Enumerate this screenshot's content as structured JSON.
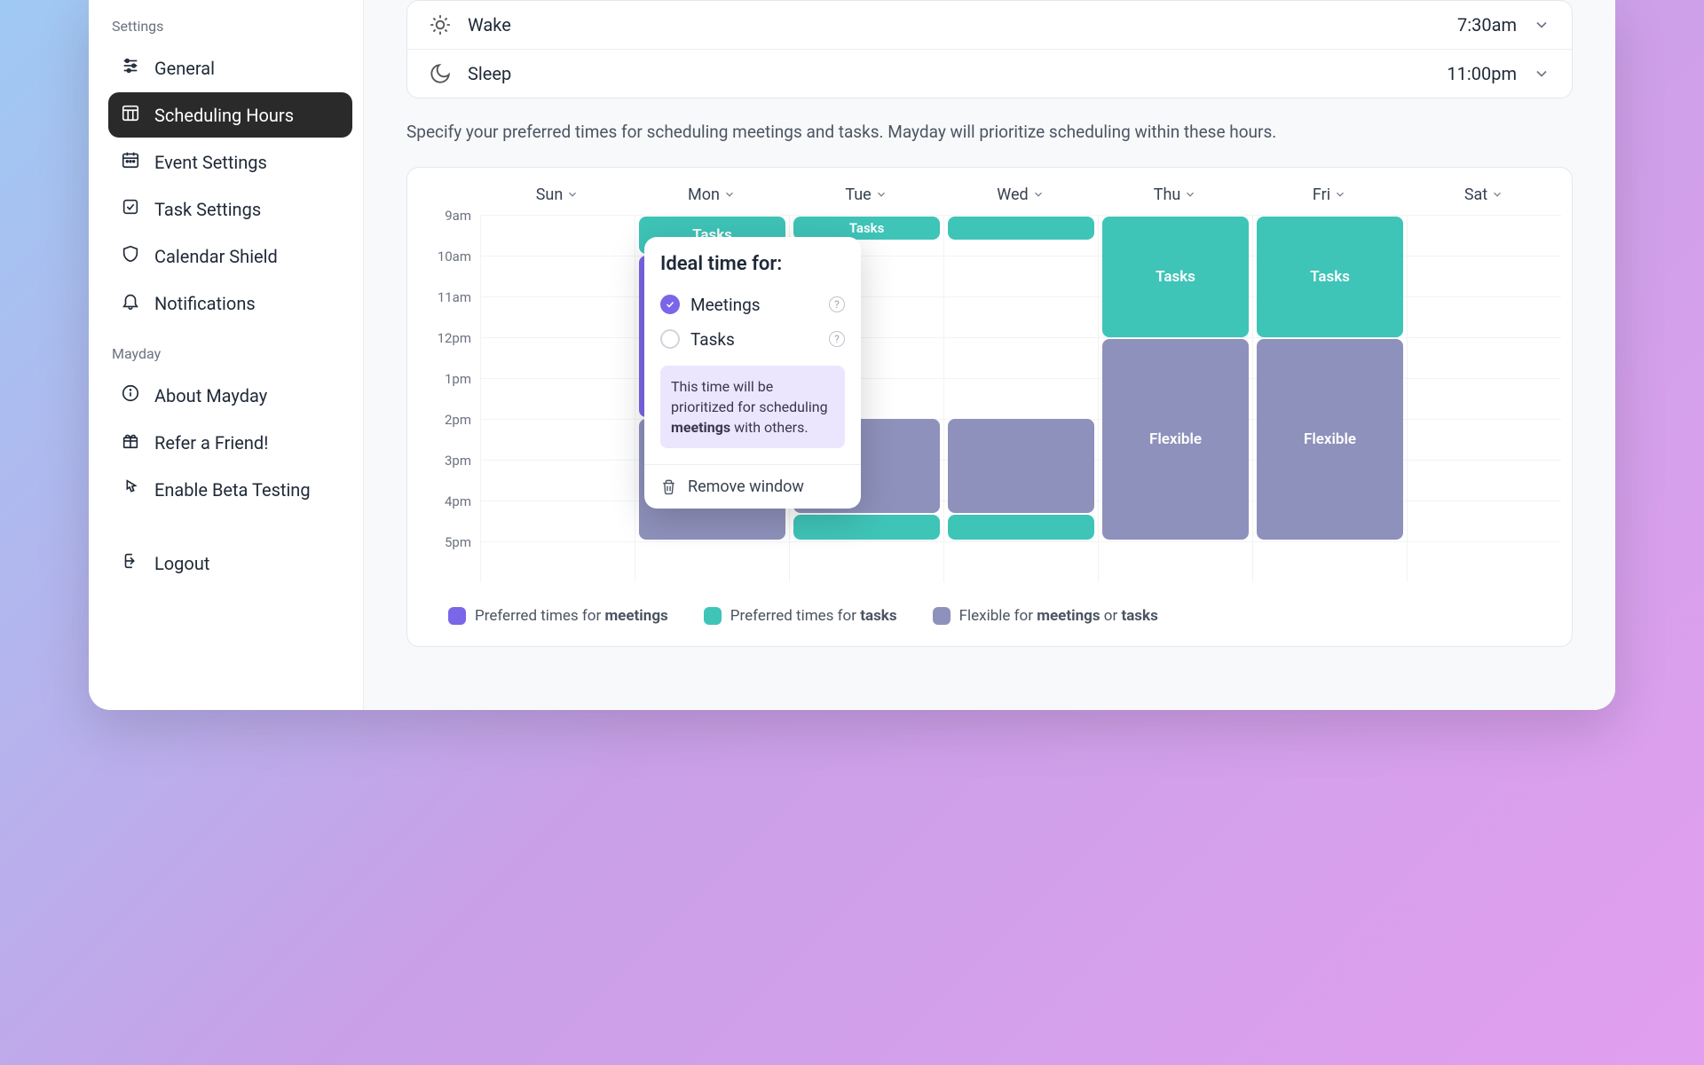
{
  "sidebar": {
    "section_settings": "Settings",
    "section_mayday": "Mayday",
    "items": {
      "general": "General",
      "scheduling": "Scheduling Hours",
      "event": "Event Settings",
      "task": "Task Settings",
      "shield": "Calendar Shield",
      "notifications": "Notifications",
      "about": "About Mayday",
      "refer": "Refer a Friend!",
      "beta": "Enable Beta Testing",
      "logout": "Logout"
    }
  },
  "times": {
    "wake_label": "Wake",
    "wake_value": "7:30am",
    "sleep_label": "Sleep",
    "sleep_value": "11:00pm"
  },
  "description": "Specify your preferred times for scheduling meetings and tasks. Mayday will prioritize scheduling within these hours.",
  "days": [
    "Sun",
    "Mon",
    "Tue",
    "Wed",
    "Thu",
    "Fri",
    "Sat"
  ],
  "hours": [
    "9am",
    "10am",
    "11am",
    "12pm",
    "1pm",
    "2pm",
    "3pm",
    "4pm",
    "5pm"
  ],
  "blocks": {
    "tasks": "Tasks",
    "meetings": "Meetings",
    "flexible": "Flexible"
  },
  "legend": {
    "meetings_pre": "Preferred times for ",
    "meetings_b": "meetings",
    "tasks_pre": "Preferred times for ",
    "tasks_b": "tasks",
    "flex_pre": "Flexible for ",
    "flex_b1": "meetings",
    "flex_mid": " or ",
    "flex_b2": "tasks"
  },
  "popover": {
    "title": "Ideal time for:",
    "opt_meetings": "Meetings",
    "opt_tasks": "Tasks",
    "info_pre": "This time will be prioritized for scheduling ",
    "info_b": "meetings",
    "info_post": " with others.",
    "remove": "Remove window"
  },
  "colors": {
    "meetings": "#7a66e8",
    "tasks": "#3fc4b8",
    "flexible": "#8e91bb"
  }
}
